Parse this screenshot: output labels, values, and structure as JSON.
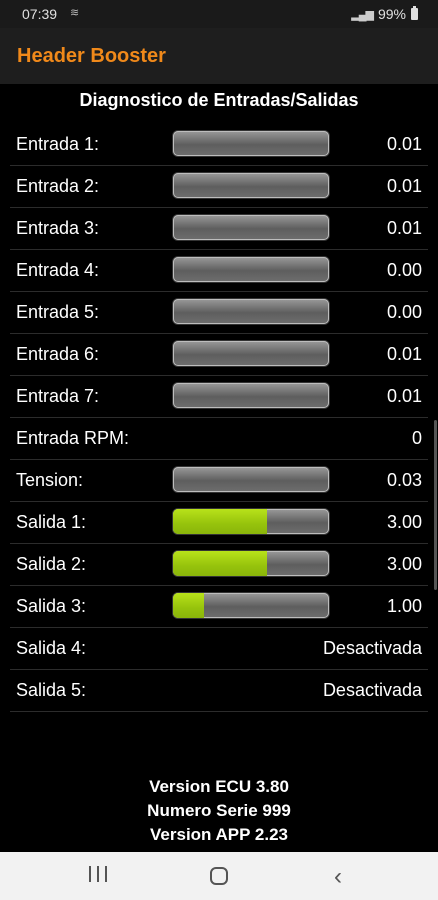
{
  "status": {
    "time": "07:39",
    "battery": "99%"
  },
  "app": {
    "title": "Header Booster"
  },
  "section_title": "Diagnostico de Entradas/Salidas",
  "rows": [
    {
      "label": "Entrada 1:",
      "value": "0.01",
      "bar": true,
      "fill_percent": 0
    },
    {
      "label": "Entrada 2:",
      "value": "0.01",
      "bar": true,
      "fill_percent": 0
    },
    {
      "label": "Entrada 3:",
      "value": "0.01",
      "bar": true,
      "fill_percent": 0
    },
    {
      "label": "Entrada 4:",
      "value": "0.00",
      "bar": true,
      "fill_percent": 0
    },
    {
      "label": "Entrada 5:",
      "value": "0.00",
      "bar": true,
      "fill_percent": 0
    },
    {
      "label": "Entrada 6:",
      "value": "0.01",
      "bar": true,
      "fill_percent": 0
    },
    {
      "label": "Entrada 7:",
      "value": "0.01",
      "bar": true,
      "fill_percent": 0
    },
    {
      "label": "Entrada RPM:",
      "value": "0",
      "bar": false
    },
    {
      "label": "Tension:",
      "value": "0.03",
      "bar": true,
      "fill_percent": 0
    },
    {
      "label": "Salida 1:",
      "value": "3.00",
      "bar": true,
      "fill_percent": 60
    },
    {
      "label": "Salida 2:",
      "value": "3.00",
      "bar": true,
      "fill_percent": 60
    },
    {
      "label": "Salida 3:",
      "value": "1.00",
      "bar": true,
      "fill_percent": 20
    },
    {
      "label": "Salida 4:",
      "value": "Desactivada",
      "bar": false
    },
    {
      "label": "Salida 5:",
      "value": "Desactivada",
      "bar": false
    }
  ],
  "footer": {
    "ecu_version": "Version ECU 3.80",
    "serial": "Numero Serie 999",
    "app_version": "Version APP 2.23"
  },
  "colors": {
    "accent": "#f0891a",
    "bar_fill": "#9ccc10",
    "background": "#000000"
  },
  "nav": {
    "icons": [
      "recent-apps-icon",
      "home-icon",
      "back-icon"
    ]
  }
}
